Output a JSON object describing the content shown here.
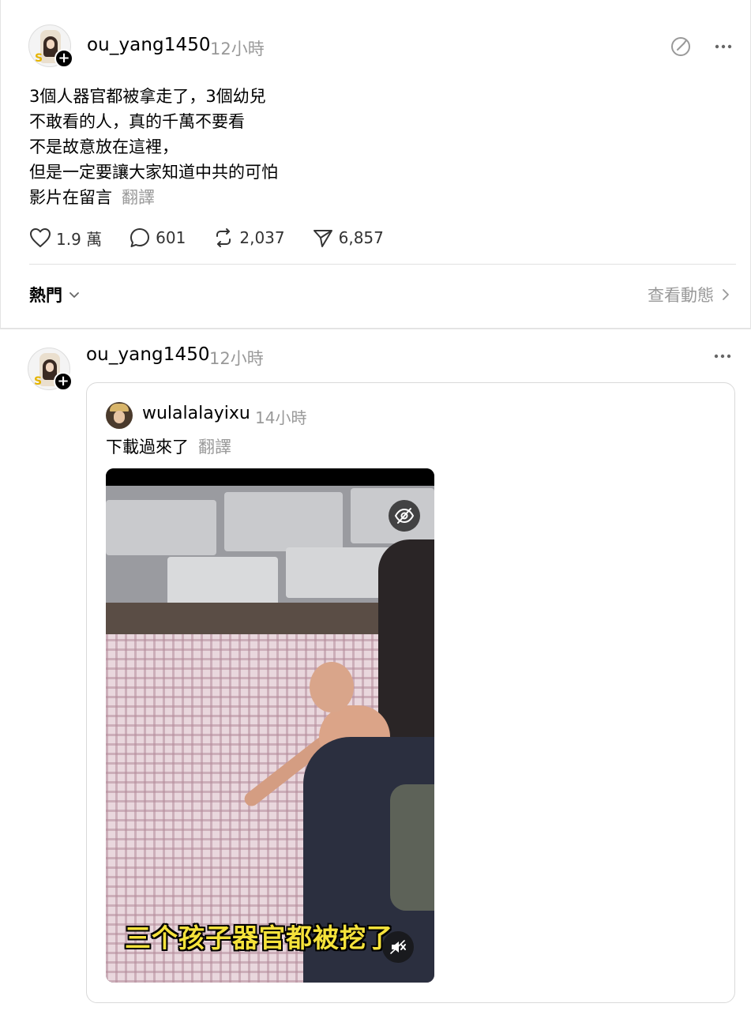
{
  "post": {
    "username": "ou_yang1450",
    "time": "12小時",
    "body_lines": [
      "3個人器官都被拿走了，3個幼兒",
      "不敢看的人，真的千萬不要看",
      "不是故意放在這裡，",
      "但是一定要讓大家知道中共的可怕",
      "影片在留言"
    ],
    "translate_label": "翻譯",
    "likes": "1.9 萬",
    "comments": "601",
    "reposts": "2,037",
    "shares": "6,857"
  },
  "sort": {
    "label": "熱門",
    "activity_label": "查看動態"
  },
  "reply": {
    "username": "ou_yang1450",
    "time": "12小時",
    "quote": {
      "username": "wulalalayixu",
      "time": "14小時",
      "text": "下載過來了",
      "translate_label": "翻譯",
      "video_subtitle": "三个孩子器官都被挖了"
    }
  },
  "icons": {
    "like": "heart-icon",
    "comment": "comment-bubble-icon",
    "repost": "repost-icon",
    "share": "send-icon",
    "more": "more-dots-icon",
    "edit": "edit-icon",
    "hidden": "eye-off-icon",
    "mute": "speaker-muted-icon",
    "chevron_down": "chevron-down-icon",
    "chevron_right": "chevron-right-icon",
    "follow": "plus-icon"
  }
}
